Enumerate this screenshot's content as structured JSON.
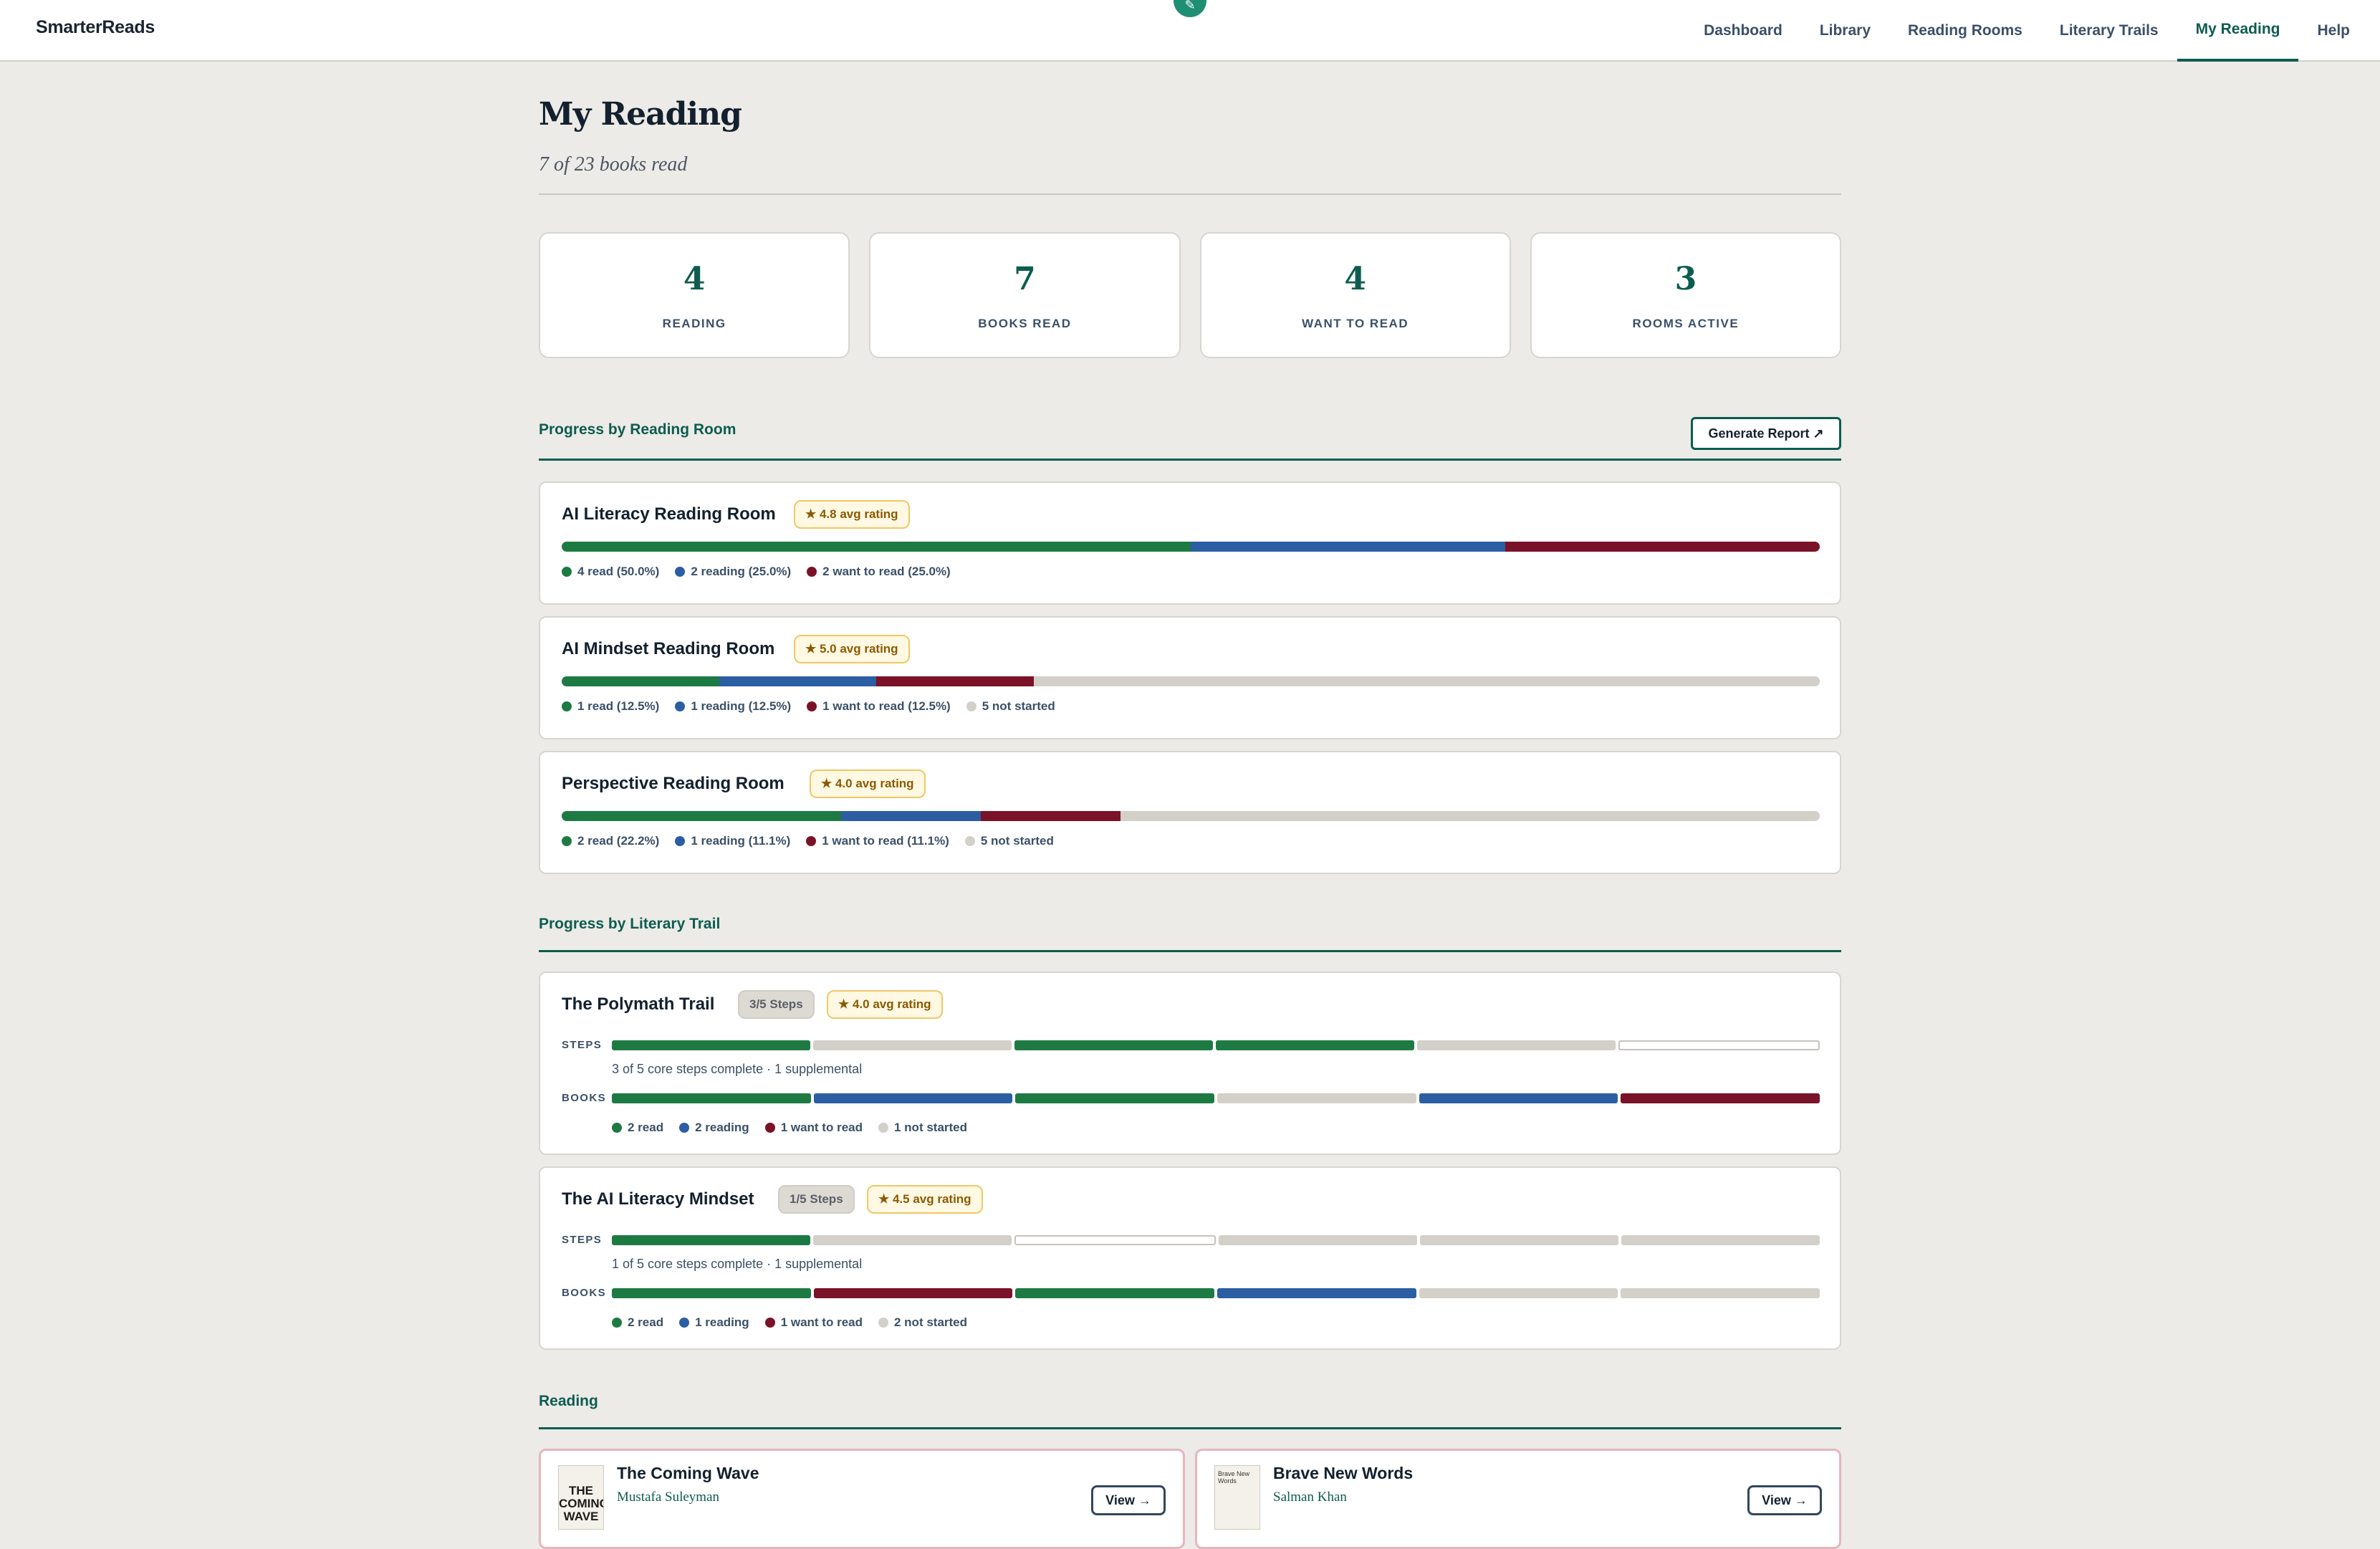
{
  "app": {
    "brand": "SmarterReads",
    "fab_icon": "pencil-icon"
  },
  "nav": {
    "items": [
      "Dashboard",
      "Library",
      "Reading Rooms",
      "Literary Trails",
      "My Reading",
      "Help"
    ],
    "active": "My Reading"
  },
  "page": {
    "title": "My Reading",
    "subtitle": "7 of 23 books read"
  },
  "stats": [
    {
      "value": "4",
      "label": "READING"
    },
    {
      "value": "7",
      "label": "BOOKS READ"
    },
    {
      "value": "4",
      "label": "WANT TO READ"
    },
    {
      "value": "3",
      "label": "ROOMS ACTIVE"
    }
  ],
  "colors": {
    "read": "#1e7a43",
    "reading": "#2b5ea2",
    "want": "#7a1228",
    "not_started": "#d3d0ca",
    "accent": "#0d5c4f"
  },
  "rooms_section": {
    "title": "Progress by Reading Room",
    "button": "Generate Report ↗",
    "rooms": [
      {
        "name": "AI Literacy Reading Room",
        "rating": "★ 4.8 avg rating",
        "progress": {
          "read": 50.0,
          "reading": 25.0,
          "want": 25.0,
          "not": 0
        },
        "legend": [
          "4 read (50.0%)",
          "2 reading (25.0%)",
          "2 want to read (25.0%)"
        ]
      },
      {
        "name": "AI Mindset Reading Room",
        "rating": "★ 5.0 avg rating",
        "progress": {
          "read": 12.5,
          "reading": 12.5,
          "want": 12.5,
          "not": 62.5
        },
        "legend": [
          "1 read (12.5%)",
          "1 reading (12.5%)",
          "1 want to read (12.5%)",
          "5 not started"
        ]
      },
      {
        "name": "Perspective Reading Room",
        "rating": "★ 4.0 avg rating",
        "progress": {
          "read": 22.2,
          "reading": 11.1,
          "want": 11.1,
          "not": 55.6
        },
        "legend": [
          "2 read (22.2%)",
          "1 reading (11.1%)",
          "1 want to read (11.1%)",
          "5 not started"
        ]
      }
    ]
  },
  "trails_section": {
    "title": "Progress by Literary Trail",
    "steps_label": "STEPS",
    "books_label": "BOOKS",
    "trails": [
      {
        "name": "The Polymath Trail",
        "steps_pill": "3/5 Steps",
        "rating": "★ 4.0 avg rating",
        "steps": [
          "done",
          "todo",
          "done",
          "done",
          "todo",
          "supp"
        ],
        "steps_note": "3 of 5 core steps complete  ·  1 supplemental",
        "books": [
          "done",
          "reading",
          "done",
          "not",
          "reading",
          "want"
        ],
        "books_legend": [
          "2 read",
          "2 reading",
          "1 want to read",
          "1 not started"
        ]
      },
      {
        "name": "The AI Literacy Mindset",
        "steps_pill": "1/5 Steps",
        "rating": "★ 4.5 avg rating",
        "steps": [
          "done",
          "todo",
          "supp",
          "todo",
          "todo",
          "todo"
        ],
        "steps_note": "1 of 5 core steps complete  ·  1 supplemental",
        "books": [
          "done",
          "want",
          "done",
          "reading",
          "not",
          "not"
        ],
        "books_legend": [
          "2 read",
          "1 reading",
          "1 want to read",
          "2 not started"
        ]
      }
    ]
  },
  "reading_section": {
    "title": "Reading",
    "books": [
      {
        "title": "The Coming Wave",
        "author": "Mustafa Suleyman",
        "cover_text": "THE COMING WAVE",
        "button": "View →"
      },
      {
        "title": "Brave New Words",
        "author": "Salman Khan",
        "cover_text": "Brave New Words",
        "button": "View →"
      }
    ]
  }
}
